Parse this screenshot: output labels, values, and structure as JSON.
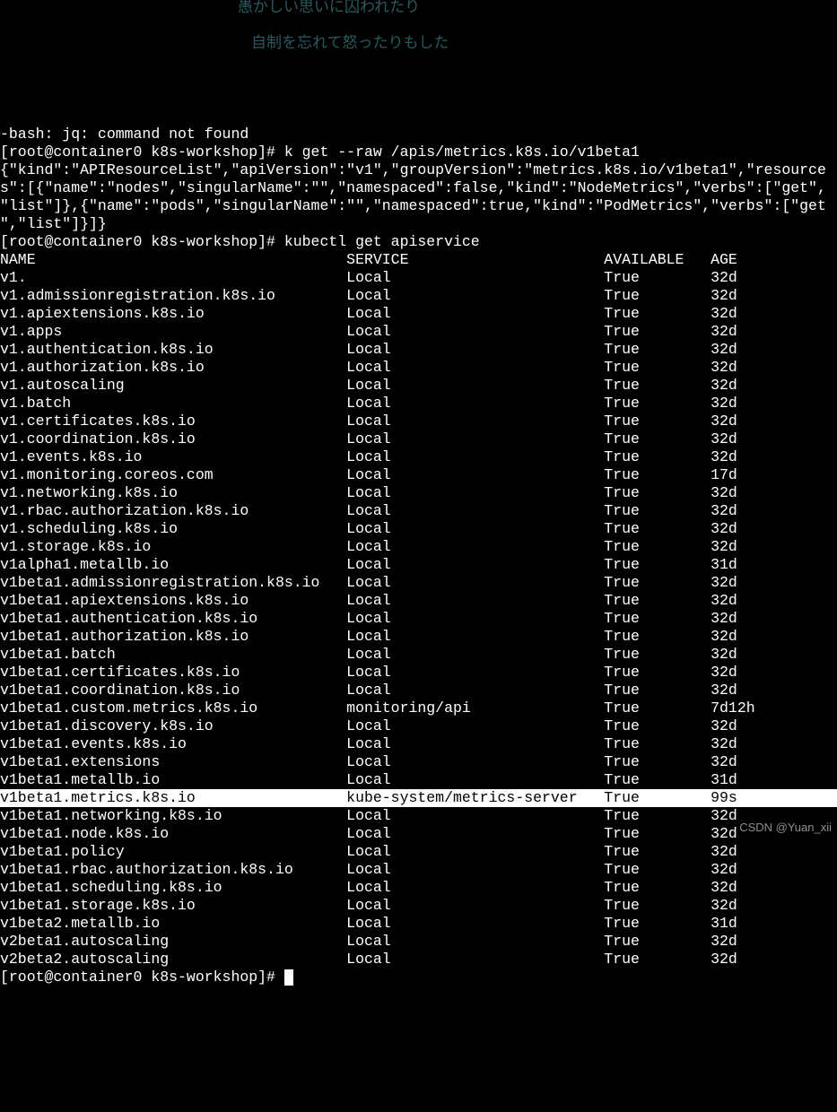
{
  "ghost_lines": [
    "愚かしい思いに囚われたり",
    "自制を忘れて怒ったりもした"
  ],
  "pre_lines": [
    "-bash: jq: command not found",
    "[root@container0 k8s-workshop]# k get --raw /apis/metrics.k8s.io/v1beta1",
    "{\"kind\":\"APIResourceList\",\"apiVersion\":\"v1\",\"groupVersion\":\"metrics.k8s.io/v1beta1\",\"resources\":[{\"name\":\"nodes\",\"singularName\":\"\",\"namespaced\":false,\"kind\":\"NodeMetrics\",\"verbs\":[\"get\",\"list\"]},{\"name\":\"pods\",\"singularName\":\"\",\"namespaced\":true,\"kind\":\"PodMetrics\",\"verbs\":[\"get\",\"list\"]}]}",
    "[root@container0 k8s-workshop]# kubectl get apiservice"
  ],
  "columns": [
    "NAME",
    "SERVICE",
    "AVAILABLE",
    "AGE"
  ],
  "rows": [
    {
      "name": "v1.",
      "service": "Local",
      "available": "True",
      "age": "32d",
      "hl": false
    },
    {
      "name": "v1.admissionregistration.k8s.io",
      "service": "Local",
      "available": "True",
      "age": "32d",
      "hl": false
    },
    {
      "name": "v1.apiextensions.k8s.io",
      "service": "Local",
      "available": "True",
      "age": "32d",
      "hl": false
    },
    {
      "name": "v1.apps",
      "service": "Local",
      "available": "True",
      "age": "32d",
      "hl": false
    },
    {
      "name": "v1.authentication.k8s.io",
      "service": "Local",
      "available": "True",
      "age": "32d",
      "hl": false
    },
    {
      "name": "v1.authorization.k8s.io",
      "service": "Local",
      "available": "True",
      "age": "32d",
      "hl": false
    },
    {
      "name": "v1.autoscaling",
      "service": "Local",
      "available": "True",
      "age": "32d",
      "hl": false
    },
    {
      "name": "v1.batch",
      "service": "Local",
      "available": "True",
      "age": "32d",
      "hl": false
    },
    {
      "name": "v1.certificates.k8s.io",
      "service": "Local",
      "available": "True",
      "age": "32d",
      "hl": false
    },
    {
      "name": "v1.coordination.k8s.io",
      "service": "Local",
      "available": "True",
      "age": "32d",
      "hl": false
    },
    {
      "name": "v1.events.k8s.io",
      "service": "Local",
      "available": "True",
      "age": "32d",
      "hl": false
    },
    {
      "name": "v1.monitoring.coreos.com",
      "service": "Local",
      "available": "True",
      "age": "17d",
      "hl": false
    },
    {
      "name": "v1.networking.k8s.io",
      "service": "Local",
      "available": "True",
      "age": "32d",
      "hl": false
    },
    {
      "name": "v1.rbac.authorization.k8s.io",
      "service": "Local",
      "available": "True",
      "age": "32d",
      "hl": false
    },
    {
      "name": "v1.scheduling.k8s.io",
      "service": "Local",
      "available": "True",
      "age": "32d",
      "hl": false
    },
    {
      "name": "v1.storage.k8s.io",
      "service": "Local",
      "available": "True",
      "age": "32d",
      "hl": false
    },
    {
      "name": "v1alpha1.metallb.io",
      "service": "Local",
      "available": "True",
      "age": "31d",
      "hl": false
    },
    {
      "name": "v1beta1.admissionregistration.k8s.io",
      "service": "Local",
      "available": "True",
      "age": "32d",
      "hl": false
    },
    {
      "name": "v1beta1.apiextensions.k8s.io",
      "service": "Local",
      "available": "True",
      "age": "32d",
      "hl": false
    },
    {
      "name": "v1beta1.authentication.k8s.io",
      "service": "Local",
      "available": "True",
      "age": "32d",
      "hl": false
    },
    {
      "name": "v1beta1.authorization.k8s.io",
      "service": "Local",
      "available": "True",
      "age": "32d",
      "hl": false
    },
    {
      "name": "v1beta1.batch",
      "service": "Local",
      "available": "True",
      "age": "32d",
      "hl": false
    },
    {
      "name": "v1beta1.certificates.k8s.io",
      "service": "Local",
      "available": "True",
      "age": "32d",
      "hl": false
    },
    {
      "name": "v1beta1.coordination.k8s.io",
      "service": "Local",
      "available": "True",
      "age": "32d",
      "hl": false
    },
    {
      "name": "v1beta1.custom.metrics.k8s.io",
      "service": "monitoring/api",
      "available": "True",
      "age": "7d12h",
      "hl": false
    },
    {
      "name": "v1beta1.discovery.k8s.io",
      "service": "Local",
      "available": "True",
      "age": "32d",
      "hl": false
    },
    {
      "name": "v1beta1.events.k8s.io",
      "service": "Local",
      "available": "True",
      "age": "32d",
      "hl": false
    },
    {
      "name": "v1beta1.extensions",
      "service": "Local",
      "available": "True",
      "age": "32d",
      "hl": false
    },
    {
      "name": "v1beta1.metallb.io",
      "service": "Local",
      "available": "True",
      "age": "31d",
      "hl": false
    },
    {
      "name": "v1beta1.metrics.k8s.io",
      "service": "kube-system/metrics-server",
      "available": "True",
      "age": "99s",
      "hl": true
    },
    {
      "name": "v1beta1.networking.k8s.io",
      "service": "Local",
      "available": "True",
      "age": "32d",
      "hl": false
    },
    {
      "name": "v1beta1.node.k8s.io",
      "service": "Local",
      "available": "True",
      "age": "32d",
      "hl": false
    },
    {
      "name": "v1beta1.policy",
      "service": "Local",
      "available": "True",
      "age": "32d",
      "hl": false
    },
    {
      "name": "v1beta1.rbac.authorization.k8s.io",
      "service": "Local",
      "available": "True",
      "age": "32d",
      "hl": false
    },
    {
      "name": "v1beta1.scheduling.k8s.io",
      "service": "Local",
      "available": "True",
      "age": "32d",
      "hl": false
    },
    {
      "name": "v1beta1.storage.k8s.io",
      "service": "Local",
      "available": "True",
      "age": "32d",
      "hl": false
    },
    {
      "name": "v1beta2.metallb.io",
      "service": "Local",
      "available": "True",
      "age": "31d",
      "hl": false
    },
    {
      "name": "v2beta1.autoscaling",
      "service": "Local",
      "available": "True",
      "age": "32d",
      "hl": false
    },
    {
      "name": "v2beta2.autoscaling",
      "service": "Local",
      "available": "True",
      "age": "32d",
      "hl": false
    }
  ],
  "prompt_tail": "[root@container0 k8s-workshop]# ",
  "watermark": "CSDN @Yuan_xii",
  "col_widths": {
    "name": 39,
    "service": 29,
    "available": 12
  }
}
